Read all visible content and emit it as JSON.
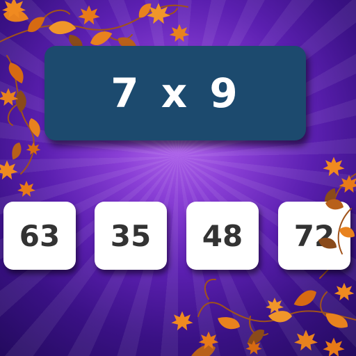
{
  "question": {
    "text": "7 x 9"
  },
  "answers": [
    {
      "label": "63"
    },
    {
      "label": "35"
    },
    {
      "label": "48"
    },
    {
      "label": "72"
    }
  ],
  "colors": {
    "background_center": "#b86ef0",
    "background_edge": "#230a5e",
    "question_panel": "#1c4a6e",
    "question_text": "#ffffff",
    "answer_box": "#ffffff",
    "answer_text": "#333333",
    "leaf_orange": "#e8821e",
    "leaf_brown": "#8a4a1a"
  },
  "decoration": {
    "leaf_icon": "autumn-leaf-icon",
    "vine_icon": "curly-vine-icon"
  }
}
